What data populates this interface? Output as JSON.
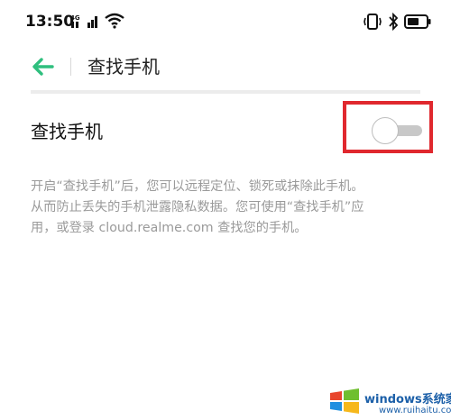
{
  "status_bar": {
    "time": "13:50",
    "icons": [
      "network-4g-icon",
      "signal-icon",
      "wifi-icon",
      "vibrate-icon",
      "bluetooth-icon",
      "battery-icon"
    ]
  },
  "header": {
    "back_icon": "arrow-left-icon",
    "title": "查找手机"
  },
  "setting": {
    "label": "查找手机",
    "toggle_state": "off"
  },
  "description": {
    "lines": [
      "开启“查找手机”后，您可以远程定位、锁死或抹除此手机。",
      "从而防止丢失的手机泄露隐私数据。您可使用“查找手机”应",
      "用，或登录 cloud.realme.com 查找您的手机。"
    ]
  },
  "watermark": {
    "brand": "windows系统家园",
    "url": "www.ruihaitu.com"
  },
  "colors": {
    "accent": "#2fbf7e",
    "highlight": "#e0282e",
    "description_text": "#9a9a9a"
  }
}
